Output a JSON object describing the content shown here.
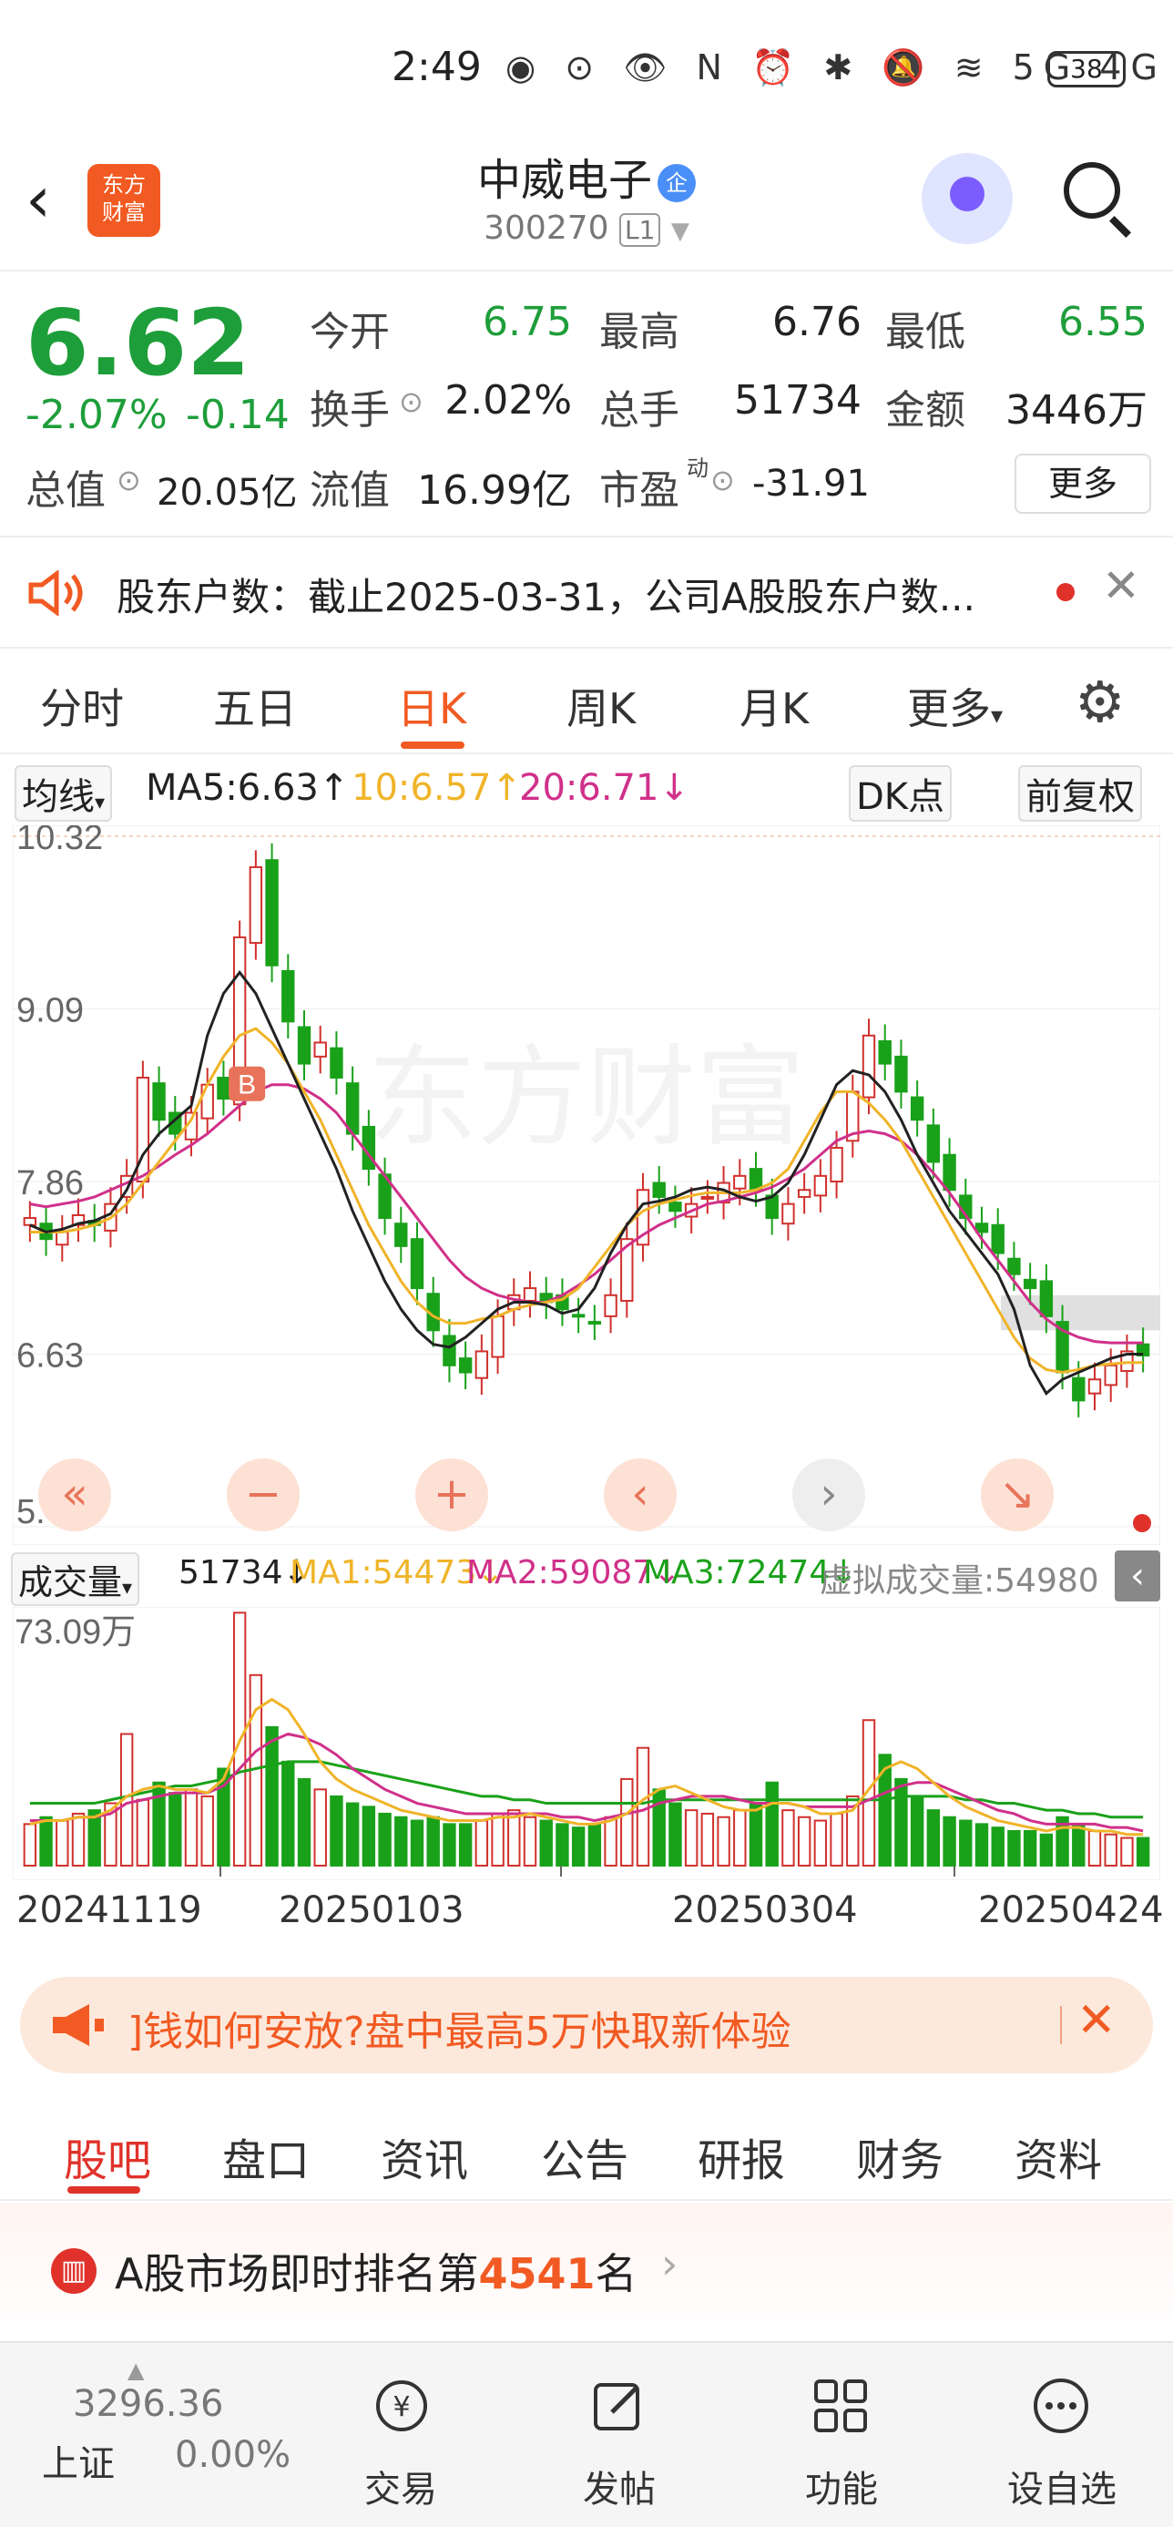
{
  "status": {
    "time": "2:49",
    "battery": "38",
    "icons": "◉ ⊙ 👁 N ⏰ ✱ 🔕 ≋ 5G 4G"
  },
  "header": {
    "logo_line1": "东方",
    "logo_line2": "财富",
    "name": "中威电子",
    "name_badge": "企",
    "code": "300270",
    "level": "L1"
  },
  "quote": {
    "price": "6.62",
    "change_pct": "-2.07%",
    "change": "-0.14",
    "open_label": "今开",
    "open": "6.75",
    "high_label": "最高",
    "high": "6.76",
    "low_label": "最低",
    "low": "6.55",
    "turnover_label": "换手",
    "turnover": "2.02%",
    "volume_label": "总手",
    "volume": "51734",
    "amount_label": "金额",
    "amount": "3446万",
    "mktcap_label": "总值",
    "mktcap": "20.05亿",
    "float_label": "流值",
    "float": "16.99亿",
    "pe_label": "市盈",
    "pe_sup": "动",
    "pe": "-31.91",
    "more": "更多"
  },
  "notice": {
    "text": "股东户数：截止2025-03-31，公司A股股东户数..."
  },
  "ktabs": [
    "分时",
    "五日",
    "日K",
    "周K",
    "月K",
    "更多"
  ],
  "ma_row": {
    "selector": "均线",
    "ma5": "MA5:6.63↑",
    "ma10": "10:6.57↑",
    "ma20": "20:6.71↓",
    "dk": "DK点",
    "adjust": "前复权"
  },
  "vol_row": {
    "selector": "成交量",
    "vol": "51734↓",
    "ma1": "MA1:54473↓",
    "ma2": "MA2:59087↓",
    "ma3": "MA3:72474↓",
    "virtual": "虚拟成交量:54980"
  },
  "colors": {
    "up": "#d0312d",
    "down": "#1aa11a",
    "ma5": "#222222",
    "ma10": "#f0b429",
    "ma20": "#d0308a",
    "accent": "#f15a22"
  },
  "chart_data": [
    {
      "type": "candlestick",
      "y_ticks": [
        "10.32",
        "9.09",
        "7.86",
        "6.63",
        "5.40"
      ],
      "ylim": [
        5.4,
        10.32
      ],
      "buy_marker": "B",
      "x_ticks": [
        "20241119",
        "20250103",
        "20250304",
        "20250424"
      ],
      "close": [
        7.6,
        7.45,
        7.5,
        7.62,
        7.55,
        7.7,
        7.9,
        8.6,
        8.3,
        8.2,
        8.35,
        8.55,
        8.45,
        9.6,
        10.1,
        9.4,
        9.0,
        8.7,
        8.85,
        8.6,
        8.2,
        7.95,
        7.6,
        7.4,
        7.1,
        6.8,
        6.55,
        6.5,
        6.65,
        6.9,
        7.05,
        7.1,
        7.0,
        6.95,
        6.9,
        6.85,
        7.05,
        7.45,
        7.8,
        7.75,
        7.65,
        7.7,
        7.75,
        7.85,
        7.9,
        7.8,
        7.6,
        7.7,
        7.8,
        7.9,
        8.1,
        8.5,
        8.9,
        8.7,
        8.5,
        8.3,
        8.0,
        7.8,
        7.6,
        7.5,
        7.35,
        7.2,
        7.1,
        6.9,
        6.5,
        6.3,
        6.45,
        6.55,
        6.65,
        6.62
      ],
      "ma5": [
        7.55,
        7.5,
        7.52,
        7.56,
        7.58,
        7.63,
        7.8,
        8.05,
        8.2,
        8.3,
        8.4,
        8.9,
        9.2,
        9.35,
        9.2,
        8.95,
        8.7,
        8.45,
        8.2,
        7.95,
        7.65,
        7.4,
        7.15,
        6.95,
        6.8,
        6.7,
        6.68,
        6.75,
        6.85,
        6.95,
        7.0,
        7.0,
        6.98,
        6.92,
        6.95,
        7.1,
        7.35,
        7.55,
        7.7,
        7.72,
        7.75,
        7.8,
        7.82,
        7.8,
        7.75,
        7.72,
        7.75,
        7.85,
        8.05,
        8.3,
        8.55,
        8.65,
        8.62,
        8.5,
        8.3,
        8.05,
        7.85,
        7.65,
        7.5,
        7.35,
        7.2,
        6.95,
        6.55,
        6.35,
        6.45,
        6.5,
        6.55,
        6.6,
        6.63,
        6.63
      ],
      "ma10": [
        7.5,
        7.5,
        7.5,
        7.52,
        7.55,
        7.6,
        7.7,
        7.85,
        8.0,
        8.15,
        8.3,
        8.55,
        8.75,
        8.9,
        8.95,
        8.85,
        8.7,
        8.5,
        8.3,
        8.05,
        7.8,
        7.55,
        7.35,
        7.15,
        7.0,
        6.9,
        6.85,
        6.85,
        6.88,
        6.9,
        6.95,
        6.98,
        7.0,
        7.02,
        7.1,
        7.25,
        7.4,
        7.55,
        7.65,
        7.7,
        7.73,
        7.76,
        7.78,
        7.78,
        7.78,
        7.8,
        7.85,
        7.95,
        8.15,
        8.35,
        8.5,
        8.5,
        8.42,
        8.3,
        8.15,
        7.95,
        7.75,
        7.55,
        7.35,
        7.15,
        6.95,
        6.75,
        6.6,
        6.52,
        6.5,
        6.52,
        6.55,
        6.56,
        6.57,
        6.57
      ],
      "ma20": [
        7.7,
        7.68,
        7.7,
        7.72,
        7.75,
        7.8,
        7.85,
        7.9,
        7.97,
        8.05,
        8.12,
        8.2,
        8.3,
        8.4,
        8.5,
        8.55,
        8.55,
        8.52,
        8.45,
        8.35,
        8.2,
        8.05,
        7.9,
        7.75,
        7.6,
        7.45,
        7.3,
        7.18,
        7.1,
        7.05,
        7.02,
        7.0,
        7.0,
        7.05,
        7.12,
        7.2,
        7.3,
        7.4,
        7.48,
        7.55,
        7.6,
        7.65,
        7.7,
        7.72,
        7.75,
        7.78,
        7.82,
        7.88,
        7.95,
        8.05,
        8.15,
        8.2,
        8.22,
        8.2,
        8.15,
        8.05,
        7.92,
        7.78,
        7.62,
        7.45,
        7.3,
        7.15,
        7.0,
        6.88,
        6.8,
        6.75,
        6.72,
        6.71,
        6.71,
        6.71
      ]
    },
    {
      "type": "bar",
      "y_ticks": [
        "73.09万"
      ],
      "ylim": [
        0,
        73.09
      ],
      "values": [
        12,
        14,
        13,
        15,
        16,
        18,
        38,
        19,
        24,
        21,
        22,
        20,
        28,
        73,
        55,
        40,
        30,
        25,
        22,
        20,
        18,
        17,
        15,
        14,
        13,
        14,
        12,
        12,
        13,
        15,
        16,
        14,
        13,
        12,
        11,
        12,
        14,
        25,
        34,
        22,
        18,
        16,
        15,
        14,
        16,
        18,
        24,
        16,
        14,
        13,
        15,
        20,
        42,
        32,
        25,
        20,
        16,
        14,
        13,
        12,
        11,
        10,
        10,
        9,
        14,
        12,
        10,
        9,
        8,
        8
      ],
      "ma1": [
        12,
        13,
        13,
        14,
        14,
        16,
        20,
        22,
        23,
        22,
        22,
        21,
        25,
        36,
        45,
        48,
        45,
        38,
        30,
        25,
        22,
        20,
        18,
        16,
        15,
        14,
        13,
        13,
        13,
        14,
        14,
        15,
        14,
        13,
        12,
        12,
        13,
        15,
        19,
        22,
        23,
        21,
        19,
        17,
        16,
        16,
        18,
        18,
        17,
        15,
        15,
        16,
        22,
        28,
        30,
        28,
        24,
        20,
        17,
        15,
        13,
        12,
        11,
        10,
        11,
        11,
        10,
        10,
        9,
        9
      ],
      "ma2": [
        13,
        13,
        13,
        14,
        14,
        15,
        18,
        19,
        20,
        21,
        21,
        21,
        23,
        28,
        33,
        36,
        38,
        37,
        35,
        32,
        28,
        25,
        22,
        20,
        18,
        17,
        16,
        15,
        15,
        15,
        15,
        15,
        15,
        14,
        14,
        13,
        14,
        15,
        16,
        18,
        19,
        20,
        20,
        20,
        19,
        18,
        18,
        18,
        17,
        17,
        17,
        17,
        19,
        21,
        23,
        24,
        24,
        22,
        20,
        18,
        16,
        15,
        13,
        12,
        12,
        12,
        12,
        11,
        11,
        10
      ],
      "ma3": [
        18,
        18,
        18,
        18,
        18,
        19,
        20,
        21,
        22,
        23,
        23,
        24,
        25,
        27,
        28,
        29,
        30,
        30,
        30,
        29,
        28,
        27,
        26,
        25,
        24,
        23,
        22,
        21,
        20,
        20,
        19,
        19,
        18,
        18,
        18,
        18,
        18,
        18,
        18,
        19,
        19,
        19,
        19,
        19,
        19,
        19,
        19,
        19,
        19,
        19,
        19,
        19,
        19,
        19,
        20,
        20,
        20,
        20,
        19,
        19,
        18,
        18,
        17,
        16,
        16,
        15,
        15,
        14,
        14,
        14
      ]
    }
  ],
  "promo": {
    "text": "]钱如何安放?盘中最高5万快取新体验"
  },
  "btabs": [
    "股吧",
    "盘口",
    "资讯",
    "公告",
    "研报",
    "财务",
    "资料"
  ],
  "rank": {
    "prefix": "A股市场即时排名第",
    "num": "4541",
    "suffix": "名"
  },
  "bnav": {
    "index_val": "3296.36",
    "index_name": "上证",
    "index_pct": "0.00%",
    "items": [
      "交易",
      "发帖",
      "功能",
      "设自选"
    ]
  }
}
